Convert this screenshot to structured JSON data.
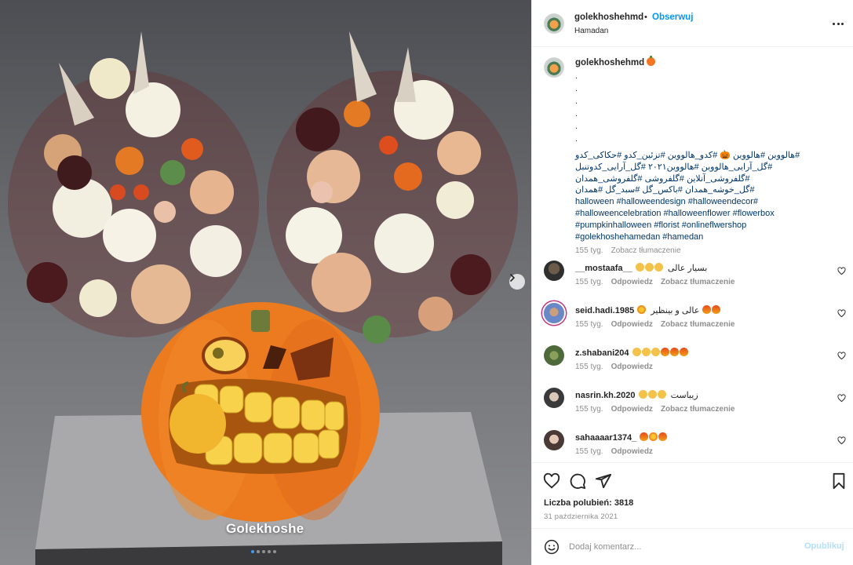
{
  "post": {
    "image_watermark": "Golekhoshe",
    "carousel": {
      "slides": 5,
      "active": 1
    }
  },
  "header": {
    "username": "golekhoshehmd",
    "separator": "•",
    "follow_label": "Obserwuj",
    "location": "Hamadan"
  },
  "caption": {
    "username": "golekhoshehmd",
    "dot_lines": ".\n.\n.\n.\n.\n.",
    "hashtags_rtl": "#هالووین #هالووین 🎃 #کدو_هالووین #تزئین_کدو #حکاکی_کدو #گل_آرایی_هالووین #هالووین۲۰۲۱ #گل_آرایی_کدوتنبل #گلفروشی_آنلاین #گلفروشی #گلفروشی_همدان #گل_خوشه_همدان #باکس_گل #سبد_گل #همدان",
    "hashtags_ltr": "halloween #halloweendesign #halloweendecor# #halloweencelebration #halloweenflower #flowerbox #pumpkinhalloween #florist #onlineflwershop #golekhoshehamedan #hamedan",
    "time": "155 tyg.",
    "translate": "Zobacz tłumaczenie"
  },
  "comments": [
    {
      "username": "__mostaafa__",
      "text": "بسیار عالی",
      "time": "155 tyg.",
      "reply": "Odpowiedz",
      "translate": "Zobacz tłumaczenie",
      "emojis": [
        "clap",
        "clap",
        "clap"
      ]
    },
    {
      "username": "seid.hadi.1985",
      "text": "عالی و بینظیر",
      "time": "155 tyg.",
      "reply": "Odpowiedz",
      "translate": "Zobacz tłumaczenie",
      "emojis": [
        "star",
        "fire",
        "fire"
      ]
    },
    {
      "username": "z.shabani204",
      "text": "",
      "time": "155 tyg.",
      "reply": "Odpowiedz",
      "translate": "",
      "emojis": [
        "clap",
        "clap",
        "clap",
        "fire",
        "fire",
        "fire"
      ]
    },
    {
      "username": "nasrin.kh.2020",
      "text": "زیباست",
      "time": "155 tyg.",
      "reply": "Odpowiedz",
      "translate": "Zobacz tłumaczenie",
      "emojis": [
        "clap",
        "clap",
        "clap"
      ]
    },
    {
      "username": "sahaaaar1374_",
      "text": "",
      "time": "155 tyg.",
      "reply": "Odpowiedz",
      "translate": "",
      "emojis": [
        "fire",
        "star",
        "fire"
      ]
    }
  ],
  "actions": {
    "likes_label": "Liczba polubień: 3818",
    "date": "31 października 2021"
  },
  "comment_box": {
    "placeholder": "Dodaj komentarz...",
    "post_label": "Opublikuj"
  },
  "colors": {
    "link": "#0095f6",
    "hashtag": "#00376b",
    "muted": "#8e8e8e",
    "pumpkin": "#ec7a1f"
  }
}
